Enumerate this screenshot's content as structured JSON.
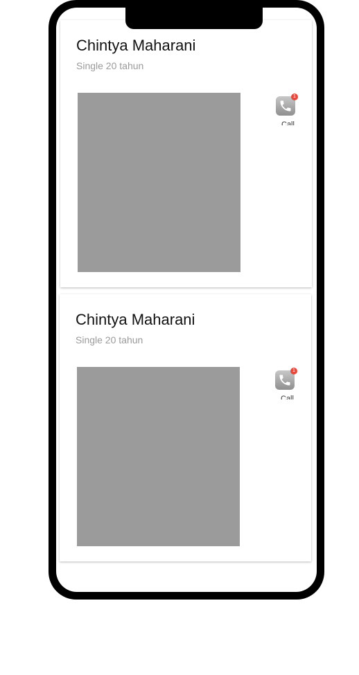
{
  "cards": [
    {
      "name": "Chintya Maharani",
      "subtitle": "Single 20 tahun",
      "call_label": "Call",
      "badge_count": "1"
    },
    {
      "name": "Chintya Maharani",
      "subtitle": "Single 20 tahun",
      "call_label": "Call",
      "badge_count": "1"
    }
  ],
  "colors": {
    "phone_frame": "#000000",
    "photo_placeholder": "#9b9b9b",
    "badge": "#e8473b",
    "subtitle_text": "#9a9a9a"
  },
  "icons": {
    "call": "phone-icon"
  }
}
